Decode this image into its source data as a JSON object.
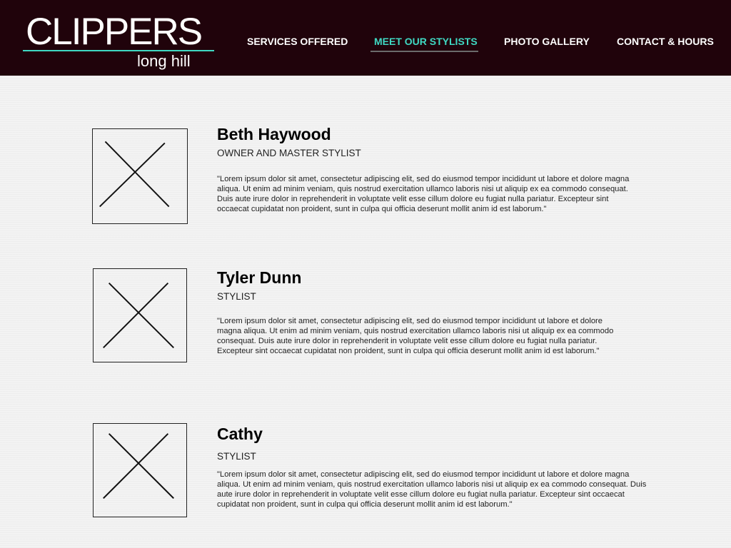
{
  "logo": {
    "main": "CLIPPERS",
    "sub": "long hill"
  },
  "nav": [
    {
      "label": "SERVICES OFFERED"
    },
    {
      "label": "MEET OUR STYLISTS",
      "active": true
    },
    {
      "label": "PHOTO GALLERY"
    },
    {
      "label": "CONTACT & HOURS"
    }
  ],
  "stylists": [
    {
      "name": "Beth Haywood",
      "role": "OWNER AND MASTER STYLIST",
      "bio": "\"Lorem ipsum dolor sit amet, consectetur adipiscing elit, sed do eiusmod tempor incididunt ut labore et dolore magna aliqua. Ut enim ad minim veniam, quis nostrud exercitation ullamco laboris nisi ut aliquip ex ea commodo consequat. Duis aute irure dolor in reprehenderit in voluptate velit esse cillum dolore eu fugiat nulla pariatur. Excepteur sint occaecat cupidatat non proident, sunt in culpa qui officia deserunt mollit anim id est laborum.\""
    },
    {
      "name": "Tyler Dunn",
      "role": "STYLIST",
      "bio": "\"Lorem ipsum dolor sit amet, consectetur adipiscing elit, sed do eiusmod tempor incididunt ut labore et dolore magna aliqua. Ut enim ad minim veniam, quis nostrud exercitation ullamco laboris nisi ut aliquip ex ea commodo consequat. Duis aute irure dolor in reprehenderit in voluptate velit esse cillum dolore eu fugiat nulla pariatur. Excepteur sint occaecat cupidatat non proident, sunt in culpa qui officia deserunt mollit anim id est laborum.\""
    },
    {
      "name": "Cathy",
      "role": "STYLIST",
      "bio": "\"Lorem ipsum dolor sit amet, consectetur adipiscing elit, sed do eiusmod tempor incididunt ut labore et dolore magna aliqua. Ut enim ad minim veniam, quis nostrud exercitation ullamco laboris nisi ut aliquip ex ea commodo consequat. Duis aute irure dolor in reprehenderit in voluptate velit esse cillum dolore eu fugiat nulla pariatur. Excepteur sint occaecat cupidatat non proident, sunt in culpa qui officia deserunt mollit anim id est laborum.\""
    }
  ],
  "colors": {
    "header_bg": "#20030b",
    "accent": "#3fd9c3"
  }
}
